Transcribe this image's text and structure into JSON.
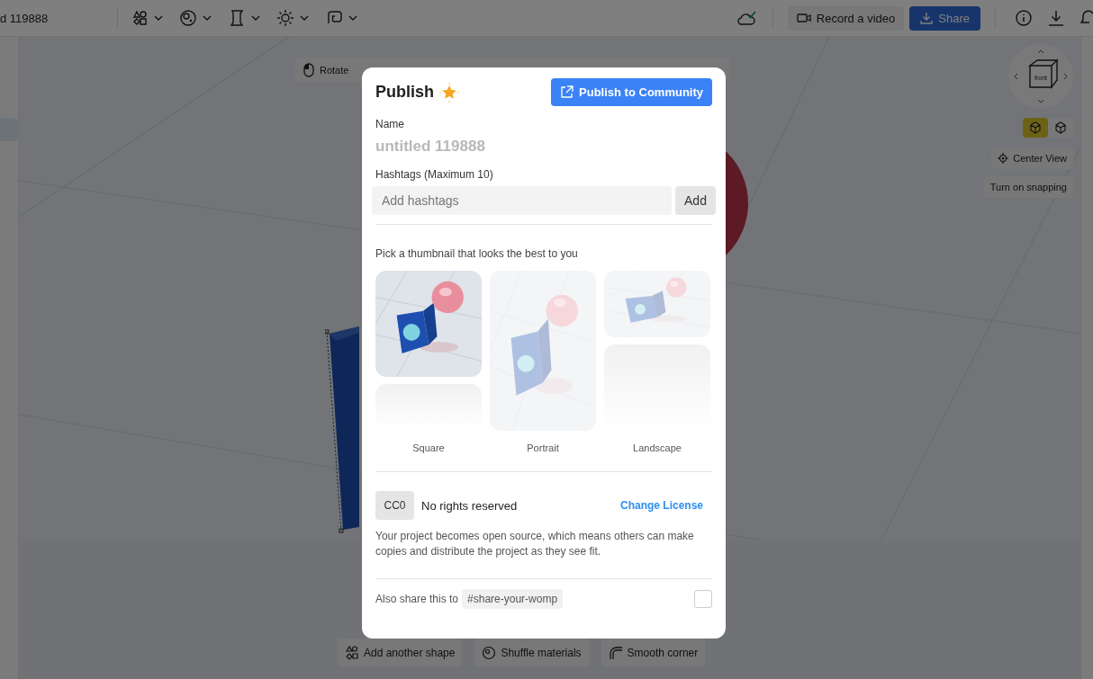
{
  "app_bar": {
    "project_title": "d 119888",
    "record_button": "Record a video",
    "share_button": "Share"
  },
  "viewport": {
    "mode_hint": "Rotate",
    "view_cube_label": "front",
    "view_modes": [
      {
        "kind": "solid",
        "selected": true
      },
      {
        "kind": "wire",
        "selected": false
      }
    ],
    "center_view": "Center View",
    "snapping": "Turn on snapping",
    "shape_actions": [
      "Add another shape",
      "Shuffle materials",
      "Smooth corner"
    ]
  },
  "dialog": {
    "title": "Publish",
    "publish_button": "Publish to Community",
    "name_label": "Name",
    "name_placeholder": "untitled 119888",
    "hashtags_label": "Hashtags (Maximum 10)",
    "hashtags_placeholder": "Add hashtags",
    "add_button": "Add",
    "thumbnail_prompt": "Pick a thumbnail that looks the best to you",
    "thumbnails": [
      {
        "label": "Square",
        "selected": true
      },
      {
        "label": "Portrait",
        "selected": false
      },
      {
        "label": "Landscape",
        "selected": false
      }
    ],
    "license": {
      "badge": "CC0",
      "name": "No rights reserved",
      "change_link": "Change License",
      "description": "Your project becomes open source, which means others can make copies and distribute the project as they see fit."
    },
    "share": {
      "label": "Also share this to",
      "tag": "#share-your-womp",
      "checked": false
    }
  }
}
